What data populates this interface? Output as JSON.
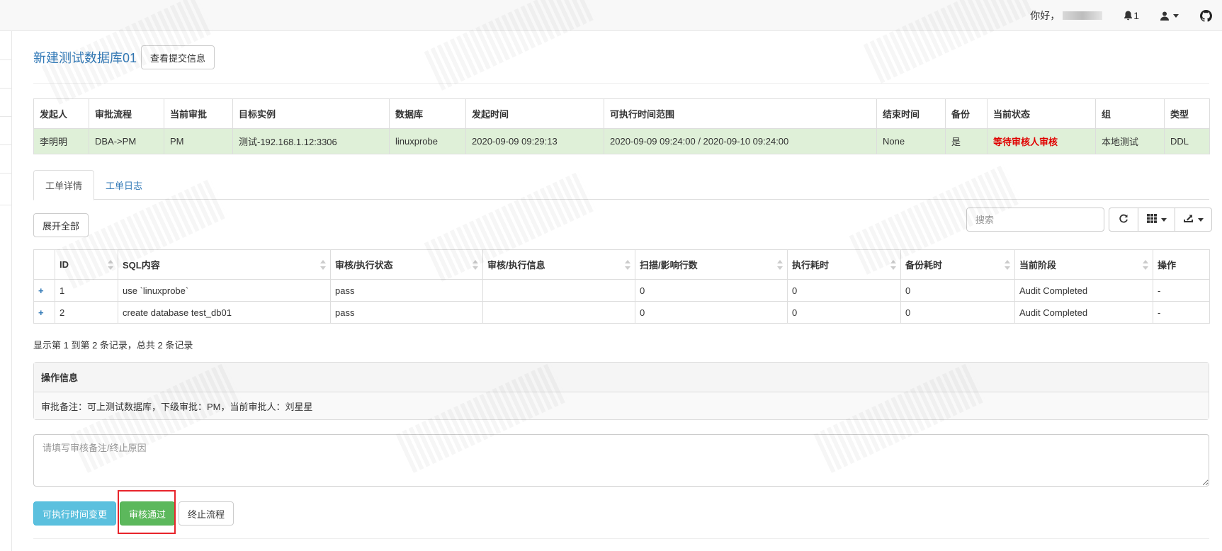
{
  "navbar": {
    "greeting": "你好，",
    "notification_count": "1",
    "icons": [
      "bell-icon",
      "user-icon",
      "github-icon"
    ]
  },
  "header": {
    "title": "新建测试数据库01",
    "view_submit_label": "查看提交信息"
  },
  "info_table": {
    "headers": [
      "发起人",
      "审批流程",
      "当前审批",
      "目标实例",
      "数据库",
      "发起时间",
      "可执行时间范围",
      "结束时间",
      "备份",
      "当前状态",
      "组",
      "类型"
    ],
    "row": {
      "initiator": "李明明",
      "flow": "DBA->PM",
      "current_approver": "PM",
      "instance": "测试-192.168.1.12:3306",
      "database": "linuxprobe",
      "created_at": "2020-09-09 09:29:13",
      "exec_window": "2020-09-09 09:24:00 / 2020-09-10 09:24:00",
      "finished_at": "None",
      "backup": "是",
      "status": "等待审核人审核",
      "group": "本地测试",
      "type": "DDL"
    }
  },
  "tabs": [
    {
      "label": "工单详情",
      "active": true
    },
    {
      "label": "工单日志",
      "active": false
    }
  ],
  "toolbar": {
    "expand_all_label": "展开全部",
    "search_placeholder": "搜索",
    "icons": [
      "refresh-icon",
      "columns-icon",
      "export-icon"
    ]
  },
  "sql_table": {
    "headers": [
      "ID",
      "SQL内容",
      "审核/执行状态",
      "审核/执行信息",
      "扫描/影响行数",
      "执行耗时",
      "备份耗时",
      "当前阶段",
      "操作"
    ],
    "rows": [
      {
        "expand": "+",
        "id": "1",
        "sql": "use `linuxprobe`",
        "status": "pass",
        "info": "",
        "rows": "0",
        "exec_time": "0",
        "backup_time": "0",
        "stage": "Audit Completed",
        "op": "-"
      },
      {
        "expand": "+",
        "id": "2",
        "sql": "create database test_db01",
        "status": "pass",
        "info": "",
        "rows": "0",
        "exec_time": "0",
        "backup_time": "0",
        "stage": "Audit Completed",
        "op": "-"
      }
    ],
    "summary": "显示第 1 到第 2 条记录，总共 2 条记录"
  },
  "operation_panel": {
    "title": "操作信息",
    "body": "审批备注：可上测试数据库，下级审批：PM，当前审批人：刘星星"
  },
  "remark": {
    "placeholder": "请填写审核备注/终止原因"
  },
  "actions": {
    "change_window_label": "可执行时间变更",
    "approve_label": "审核通过",
    "terminate_label": "终止流程"
  },
  "colors": {
    "link": "#337ab7",
    "success_row": "#dff0d8",
    "status_red": "#e00000",
    "info_button": "#5bc0de",
    "success_button": "#5cb85c",
    "highlight_box": "#e8242b"
  }
}
